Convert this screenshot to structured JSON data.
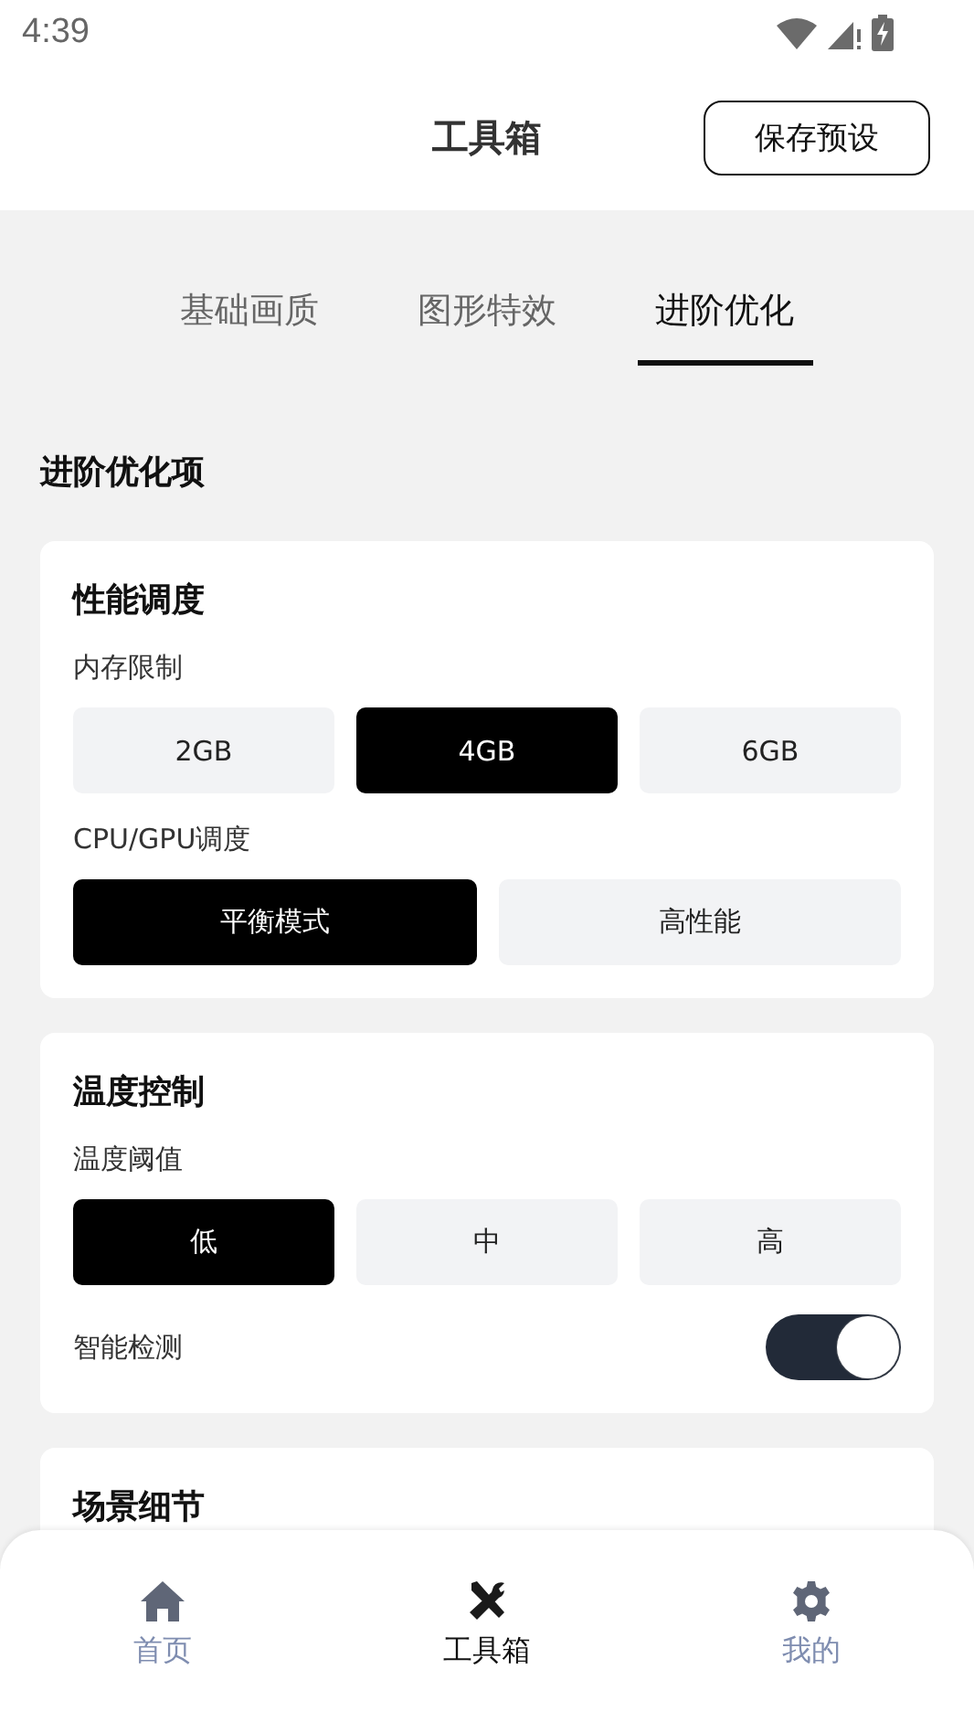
{
  "status_bar": {
    "time": "4:39"
  },
  "header": {
    "title": "工具箱",
    "action": "保存预设"
  },
  "tabs": [
    {
      "label": "基础画质",
      "selected": false
    },
    {
      "label": "图形特效",
      "selected": false
    },
    {
      "label": "进阶优化",
      "selected": true
    }
  ],
  "section_title": "进阶优化项",
  "cards": [
    {
      "title": "性能调度",
      "rows": [
        {
          "kind": "options",
          "label": "内存限制",
          "options": [
            {
              "label": "2GB",
              "selected": false
            },
            {
              "label": "4GB",
              "selected": true
            },
            {
              "label": "6GB",
              "selected": false
            }
          ]
        },
        {
          "kind": "options",
          "label": "CPU/GPU调度",
          "options": [
            {
              "label": "平衡模式",
              "selected": true
            },
            {
              "label": "高性能",
              "selected": false
            }
          ]
        }
      ]
    },
    {
      "title": "温度控制",
      "rows": [
        {
          "kind": "options",
          "label": "温度阈值",
          "options": [
            {
              "label": "低",
              "selected": true
            },
            {
              "label": "中",
              "selected": false
            },
            {
              "label": "高",
              "selected": false
            }
          ]
        },
        {
          "kind": "toggle",
          "label": "智能检测",
          "on": true
        }
      ]
    },
    {
      "title": "场景细节"
    }
  ],
  "bottom_nav": [
    {
      "label": "首页",
      "selected": false
    },
    {
      "label": "工具箱",
      "selected": true
    },
    {
      "label": "我的",
      "selected": false
    }
  ]
}
